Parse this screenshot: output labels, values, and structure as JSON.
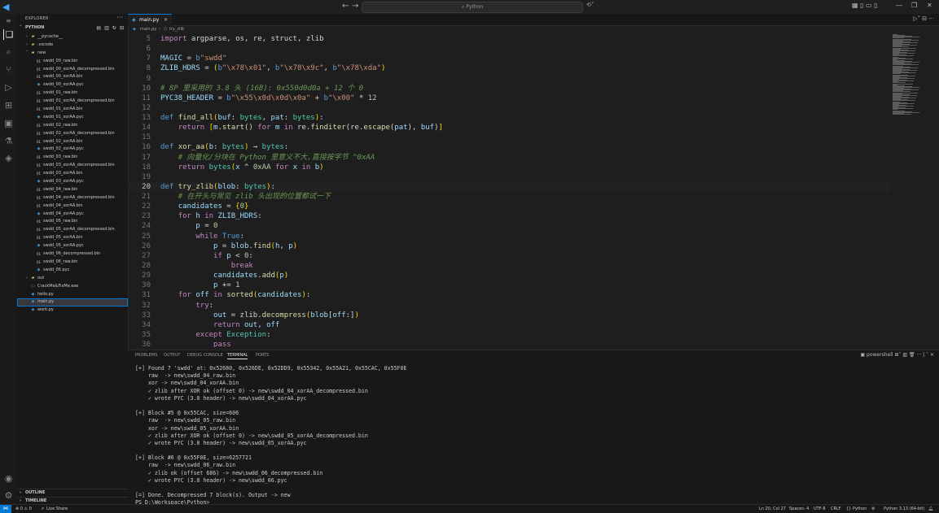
{
  "titlebar": {
    "search_text": "Python",
    "back_icon": "←",
    "forward_icon": "→",
    "copilot_icon": "⟲˅"
  },
  "sidebar": {
    "title": "EXPLORER",
    "folder": "PYTHON",
    "outline": "OUTLINE",
    "timeline": "TIMELINE",
    "tree": [
      {
        "name": "__pycache__",
        "type": "folder",
        "depth": 1,
        "open": false
      },
      {
        "name": ".vscode",
        "type": "folder",
        "depth": 1,
        "open": false
      },
      {
        "name": "new",
        "type": "folder",
        "depth": 1,
        "open": true
      },
      {
        "name": "swdd_00_raw.bin",
        "type": "bin",
        "depth": 2
      },
      {
        "name": "swdd_00_xorAA_decompressed.bin",
        "type": "bin",
        "depth": 2
      },
      {
        "name": "swdd_00_xorAA.bin",
        "type": "bin",
        "depth": 2
      },
      {
        "name": "swdd_00_xorAA.pyc",
        "type": "pyc",
        "depth": 2
      },
      {
        "name": "swdd_01_raw.bin",
        "type": "bin",
        "depth": 2
      },
      {
        "name": "swdd_01_xorAA_decompressed.bin",
        "type": "bin",
        "depth": 2
      },
      {
        "name": "swdd_01_xorAA.bin",
        "type": "bin",
        "depth": 2
      },
      {
        "name": "swdd_01_xorAA.pyc",
        "type": "pyc",
        "depth": 2
      },
      {
        "name": "swdd_02_raw.bin",
        "type": "bin",
        "depth": 2
      },
      {
        "name": "swdd_02_xorAA_decompressed.bin",
        "type": "bin",
        "depth": 2
      },
      {
        "name": "swdd_02_xorAA.bin",
        "type": "bin",
        "depth": 2
      },
      {
        "name": "swdd_02_xorAA.pyc",
        "type": "pyc",
        "depth": 2
      },
      {
        "name": "swdd_03_raw.bin",
        "type": "bin",
        "depth": 2
      },
      {
        "name": "swdd_03_xorAA_decompressed.bin",
        "type": "bin",
        "depth": 2
      },
      {
        "name": "swdd_03_xorAA.bin",
        "type": "bin",
        "depth": 2
      },
      {
        "name": "swdd_03_xorAA.pyc",
        "type": "pyc",
        "depth": 2
      },
      {
        "name": "swdd_04_raw.bin",
        "type": "bin",
        "depth": 2
      },
      {
        "name": "swdd_04_xorAA_decompressed.bin",
        "type": "bin",
        "depth": 2
      },
      {
        "name": "swdd_04_xorAA.bin",
        "type": "bin",
        "depth": 2
      },
      {
        "name": "swdd_04_xorAA.pyc",
        "type": "pyc",
        "depth": 2
      },
      {
        "name": "swdd_05_raw.bin",
        "type": "bin",
        "depth": 2
      },
      {
        "name": "swdd_05_xorAA_decompressed.bin",
        "type": "bin",
        "depth": 2
      },
      {
        "name": "swdd_05_xorAA.bin",
        "type": "bin",
        "depth": 2
      },
      {
        "name": "swdd_05_xorAA.pyc",
        "type": "pyc",
        "depth": 2
      },
      {
        "name": "swdd_06_decompressed.bin",
        "type": "bin",
        "depth": 2
      },
      {
        "name": "swdd_06_raw.bin",
        "type": "bin",
        "depth": 2
      },
      {
        "name": "swdd_06.pyc",
        "type": "pyc",
        "depth": 2
      },
      {
        "name": "out",
        "type": "folder",
        "depth": 1,
        "open": false
      },
      {
        "name": "CrackMe&FixMe.exe",
        "type": "exe",
        "depth": 1
      },
      {
        "name": "hello.py",
        "type": "py",
        "depth": 1
      },
      {
        "name": "main.py",
        "type": "py",
        "depth": 1,
        "selected": true
      },
      {
        "name": "work.py",
        "type": "py",
        "depth": 1
      }
    ]
  },
  "editor": {
    "tab_label": "main.py",
    "breadcrumb": [
      "main.py",
      "try_zlib"
    ],
    "active_line": 20,
    "lines": [
      {
        "n": "5",
        "html": "<span class=\"k\">import</span> argparse, os, re, struct, zlib"
      },
      {
        "n": "6",
        "html": ""
      },
      {
        "n": "7",
        "html": "<span class=\"v\">MAGIC</span> = <span class=\"kw\">b</span><span class=\"s\">\"swdd\"</span>"
      },
      {
        "n": "8",
        "html": "<span class=\"v\">ZLIB_HDRS</span> = <span class=\"b\">(</span><span class=\"kw\">b</span><span class=\"s\">\"\\x78\\x01\"</span>, <span class=\"kw\">b</span><span class=\"s\">\"\\x78\\x9c\"</span>, <span class=\"kw\">b</span><span class=\"s\">\"\\x78\\xda\"</span><span class=\"b\">)</span>"
      },
      {
        "n": "9",
        "html": ""
      },
      {
        "n": "10",
        "html": "<span class=\"c\"># 8P 里采用的 3.8 头 (16B): 0x550d0d0a + 12 个 0</span>"
      },
      {
        "n": "11",
        "html": "<span class=\"v\">PYC38_HEADER</span> = <span class=\"kw\">b</span><span class=\"s\">\"\\x55\\x0d\\x0d\\x0a\"</span> + <span class=\"kw\">b</span><span class=\"s\">\"\\x00\"</span> * <span class=\"n\">12</span>"
      },
      {
        "n": "12",
        "html": ""
      },
      {
        "n": "13",
        "html": "<span class=\"kw\">def</span> <span class=\"f\">find_all</span><span class=\"b\">(</span><span class=\"v\">buf</span>: <span class=\"t\">bytes</span>, <span class=\"v\">pat</span>: <span class=\"t\">bytes</span><span class=\"b\">)</span>:"
      },
      {
        "n": "14",
        "html": "    <span class=\"k\">return</span> <span class=\"b\">[</span><span class=\"v\">m</span>.<span class=\"f\">start</span>() <span class=\"k\">for</span> <span class=\"v\">m</span> <span class=\"k\">in</span> re.<span class=\"f\">finditer</span>(re.<span class=\"f\">escape</span>(<span class=\"v\">pat</span>), <span class=\"v\">buf</span>)<span class=\"b\">]</span>"
      },
      {
        "n": "15",
        "html": ""
      },
      {
        "n": "16",
        "html": "<span class=\"kw\">def</span> <span class=\"f\">xor_aa</span><span class=\"b\">(</span><span class=\"v\">b</span>: <span class=\"t\">bytes</span><span class=\"b\">)</span> → <span class=\"t\">bytes</span>:"
      },
      {
        "n": "17",
        "html": "    <span class=\"c\"># 向量化/分块在 Python 里意义不大,直接按字节 ^0xAA</span>"
      },
      {
        "n": "18",
        "html": "    <span class=\"k\">return</span> <span class=\"t\">bytes</span><span class=\"b\">(</span><span class=\"v\">x</span> ^ <span class=\"n\">0xAA</span> <span class=\"k\">for</span> <span class=\"v\">x</span> <span class=\"k\">in</span> <span class=\"v\">b</span><span class=\"b\">)</span>"
      },
      {
        "n": "19",
        "html": ""
      },
      {
        "n": "20",
        "html": "<span class=\"kw\">def</span> <span class=\"f\">try_zlib</span><span class=\"b\">(</span><span class=\"v\">blob</span>: <span class=\"t\">bytes</span><span class=\"b\">)</span>:"
      },
      {
        "n": "21",
        "html": "    <span class=\"c\"># 在开头与常见 zlib 头出现的位置都试一下</span>"
      },
      {
        "n": "22",
        "html": "    <span class=\"v\">candidates</span> = <span class=\"b\">{</span><span class=\"n\">0</span><span class=\"b\">}</span>"
      },
      {
        "n": "23",
        "html": "    <span class=\"k\">for</span> <span class=\"v\">h</span> <span class=\"k\">in</span> <span class=\"v\">ZLIB_HDRS</span>:"
      },
      {
        "n": "24",
        "html": "        <span class=\"v\">p</span> = <span class=\"n\">0</span>"
      },
      {
        "n": "25",
        "html": "        <span class=\"k\">while</span> <span class=\"kw\">True</span>:"
      },
      {
        "n": "26",
        "html": "            <span class=\"v\">p</span> = <span class=\"v\">blob</span>.<span class=\"f\">find</span><span class=\"b\">(</span><span class=\"v\">h</span>, <span class=\"v\">p</span><span class=\"b\">)</span>"
      },
      {
        "n": "27",
        "html": "            <span class=\"k\">if</span> <span class=\"v\">p</span> &lt; <span class=\"n\">0</span>:"
      },
      {
        "n": "28",
        "html": "                <span class=\"k\">break</span>"
      },
      {
        "n": "29",
        "html": "            <span class=\"v\">candidates</span>.<span class=\"f\">add</span><span class=\"b\">(</span><span class=\"v\">p</span><span class=\"b\">)</span>"
      },
      {
        "n": "30",
        "html": "            <span class=\"v\">p</span> += <span class=\"n\">1</span>"
      },
      {
        "n": "31",
        "html": "    <span class=\"k\">for</span> <span class=\"v\">off</span> <span class=\"k\">in</span> <span class=\"f\">sorted</span><span class=\"b\">(</span><span class=\"v\">candidates</span><span class=\"b\">)</span>:"
      },
      {
        "n": "32",
        "html": "        <span class=\"k\">try</span>:"
      },
      {
        "n": "33",
        "html": "            <span class=\"v\">out</span> = zlib.<span class=\"f\">decompress</span><span class=\"b\">(</span><span class=\"v\">blob</span>[<span class=\"v\">off</span>:]<span class=\"b\">)</span>"
      },
      {
        "n": "34",
        "html": "            <span class=\"k\">return</span> <span class=\"v\">out</span>, <span class=\"v\">off</span>"
      },
      {
        "n": "35",
        "html": "        <span class=\"k\">except</span> <span class=\"cls\">Exception</span>:"
      },
      {
        "n": "36",
        "html": "            <span class=\"k\">pass</span>"
      }
    ]
  },
  "panel": {
    "tabs": [
      "PROBLEMS",
      "OUTPUT",
      "DEBUG CONSOLE",
      "TERMINAL",
      "PORTS"
    ],
    "active_tab": "TERMINAL",
    "shell": "powershell",
    "terminal_lines": [
      "[+] Found 7 'swdd' at: 0x52680, 0x526DE, 0x52DD9, 0x55342, 0x55A21, 0x55CAC, 0x55F0E",
      "    raw  -> new\\swdd_04_raw.bin",
      "    xor -> new\\swdd_04_xorAA.bin",
      "    ✓ zlib after XOR ok (offset 0) -> new\\swdd_04_xorAA_decompressed.bin",
      "    ✓ wrote PYC (3.8 header) -> new\\swdd_04_xorAA.pyc",
      "",
      "[+] Block #5 @ 0x55CAC, size=606",
      "    raw  -> new\\swdd_05_raw.bin",
      "    xor -> new\\swdd_05_xorAA.bin",
      "    ✓ zlib after XOR ok (offset 0) -> new\\swdd_05_xorAA_decompressed.bin",
      "    ✓ wrote PYC (3.8 header) -> new\\swdd_05_xorAA.pyc",
      "",
      "[+] Block #6 @ 0x55F0E, size=6257721",
      "    raw  -> new\\swdd_06_raw.bin",
      "    ✓ zlib ok (offset 686) -> new\\swdd_06_decompressed.bin",
      "    ✓ wrote PYC (3.8 header) -> new\\swdd_06.pyc",
      "",
      "[=] Done. Decompressed 7 block(s). Output -> new",
      "PS D:\\Workspace\\Python> "
    ]
  },
  "statusbar": {
    "errors": "⊗ 0 ⚠ 0",
    "live_share": "Live Share",
    "position": "Ln 20, Col 27",
    "spaces": "Spaces: 4",
    "encoding": "UTF-8",
    "eol": "CRLF",
    "language": "{} Python",
    "interpreter": "Python 3.13 (64-bit)"
  }
}
